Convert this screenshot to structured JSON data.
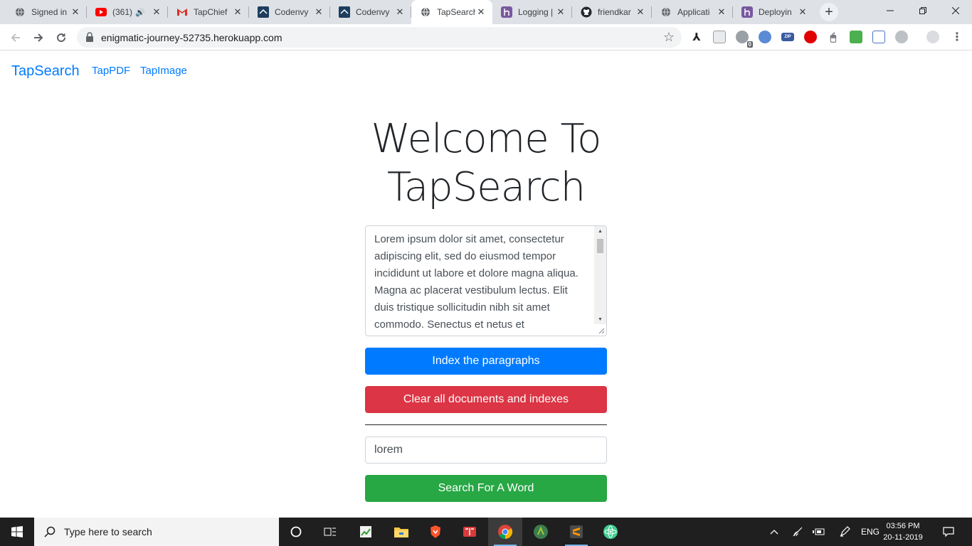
{
  "browser": {
    "tabs": [
      {
        "title": "Signed in",
        "icon": "globe-icon"
      },
      {
        "title": "(361)",
        "icon": "youtube-icon"
      },
      {
        "title": "TapChief",
        "icon": "gmail-icon"
      },
      {
        "title": "Codenvy",
        "icon": "codenvy-icon"
      },
      {
        "title": "Codenvy",
        "icon": "codenvy-icon"
      },
      {
        "title": "TapSearch",
        "icon": "globe-icon"
      },
      {
        "title": "Logging |",
        "icon": "heroku-icon"
      },
      {
        "title": "friendkar",
        "icon": "github-icon"
      },
      {
        "title": "Applicati",
        "icon": "globe-icon"
      },
      {
        "title": "Deployin",
        "icon": "heroku-icon"
      }
    ],
    "url": "enigmatic-journey-52735.herokuapp.com",
    "extension_badge": "0",
    "extension_zip": "ZIP",
    "new_tab_symbol": "+",
    "close_symbol": "✕"
  },
  "page": {
    "brand": "TapSearch",
    "nav_links": [
      "TapPDF",
      "TapImage"
    ],
    "heading": "Welcome To TapSearch",
    "paragraph_text": "Lorem ipsum dolor sit amet, consectetur adipiscing elit, sed do eiusmod tempor incididunt ut labore et dolore magna aliqua. Magna ac placerat vestibulum lectus. Elit duis tristique sollicitudin nibh sit amet commodo. Senectus et netus et",
    "index_button": "Index the paragraphs",
    "clear_button": "Clear all documents and indexes",
    "search_value": "lorem",
    "search_button": "Search For A Word"
  },
  "taskbar": {
    "search_placeholder": "Type here to search",
    "language": "ENG",
    "time": "03:56 PM",
    "date": "20-11-2019"
  },
  "colors": {
    "primary": "#007bff",
    "danger": "#dc3545",
    "success": "#28a745"
  }
}
